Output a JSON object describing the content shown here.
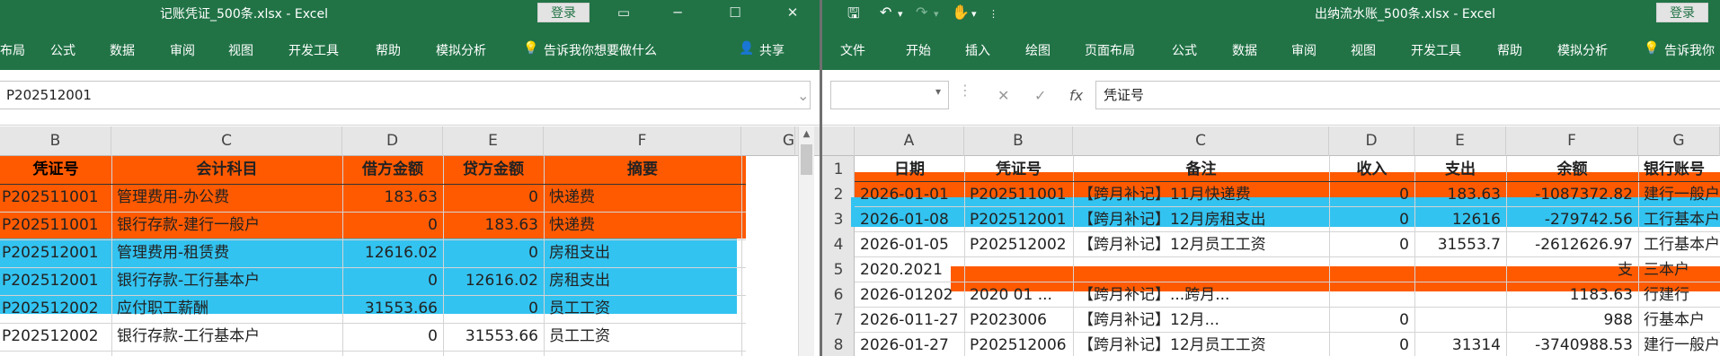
{
  "colors": {
    "excel_green": "#217346",
    "orange": "#ff5a00",
    "cyan": "#33c3f0"
  },
  "left": {
    "title": "记账凭证_500条.xlsx  -  Excel",
    "login": "登录",
    "tabs": [
      "布局",
      "公式",
      "数据",
      "审阅",
      "视图",
      "开发工具",
      "帮助",
      "模拟分析",
      "告诉我你想要做什么",
      "共享"
    ],
    "formula": "P202512001",
    "cols": [
      "B",
      "C",
      "D",
      "E",
      "F",
      "G"
    ],
    "header": [
      "凭证号",
      "会计科目",
      "借方金额",
      "贷方金额",
      "摘要"
    ],
    "rows": [
      [
        "P202511001",
        "管理费用-办公费",
        "183.63",
        "0",
        "快递费"
      ],
      [
        "P202511001",
        "银行存款-建行一般户",
        "0",
        "183.63",
        "快递费"
      ],
      [
        "P202512001",
        "管理费用-租赁费",
        "12616.02",
        "0",
        "房租支出"
      ],
      [
        "P202512001",
        "银行存款-工行基本户",
        "0",
        "12616.02",
        "房租支出"
      ],
      [
        "P202512002",
        "应付职工薪酬",
        "31553.66",
        "0",
        "员工工资"
      ],
      [
        "P202512002",
        "银行存款-工行基本户",
        "0",
        "31553.66",
        "员工工资"
      ]
    ]
  },
  "right": {
    "title": "出纳流水账_500条.xlsx  -  Excel",
    "login": "登录",
    "tabs": [
      "文件",
      "开始",
      "插入",
      "绘图",
      "页面布局",
      "公式",
      "数据",
      "审阅",
      "视图",
      "开发工具",
      "帮助",
      "模拟分析",
      "告诉我你"
    ],
    "formula": "凭证号",
    "fx": "fx",
    "cols": [
      "A",
      "B",
      "C",
      "D",
      "E",
      "F",
      "G"
    ],
    "rownums": [
      "1",
      "2",
      "3",
      "4",
      "5",
      "6",
      "7",
      "8"
    ],
    "header": [
      "日期",
      "凭证号",
      "备注",
      "收入",
      "支出",
      "余额",
      "银行账号"
    ],
    "rows": [
      [
        "2026-01-01",
        "P202511001",
        "【跨月补记】11月快递费",
        "0",
        "183.63",
        "-1087372.82",
        "建行一般户"
      ],
      [
        "2026-01-08",
        "P202512001",
        "【跨月补记】12月房租支出",
        "0",
        "12616",
        "-279742.56",
        "工行基本户"
      ],
      [
        "2026-01-05",
        "P202512002",
        "【跨月补记】12月员工工资",
        "0",
        "31553.7",
        "-2612626.97",
        "工行基本户"
      ],
      [
        "2020.2021",
        "",
        "",
        "",
        "",
        "支",
        "三本户"
      ],
      [
        "2026-01202",
        "2020 01 ...",
        "【跨月补记】...跨月...",
        "",
        "",
        "1183.63",
        "行建行"
      ],
      [
        "2026-011-27",
        "P2023006",
        "【跨月补记】12月...",
        "0",
        "",
        "988",
        "行基本户"
      ],
      [
        "2026-01-27",
        "P202512006",
        "【跨月补记】12月员工工资",
        "0",
        "31314",
        "-3740988.53",
        "建行一般户"
      ]
    ]
  }
}
